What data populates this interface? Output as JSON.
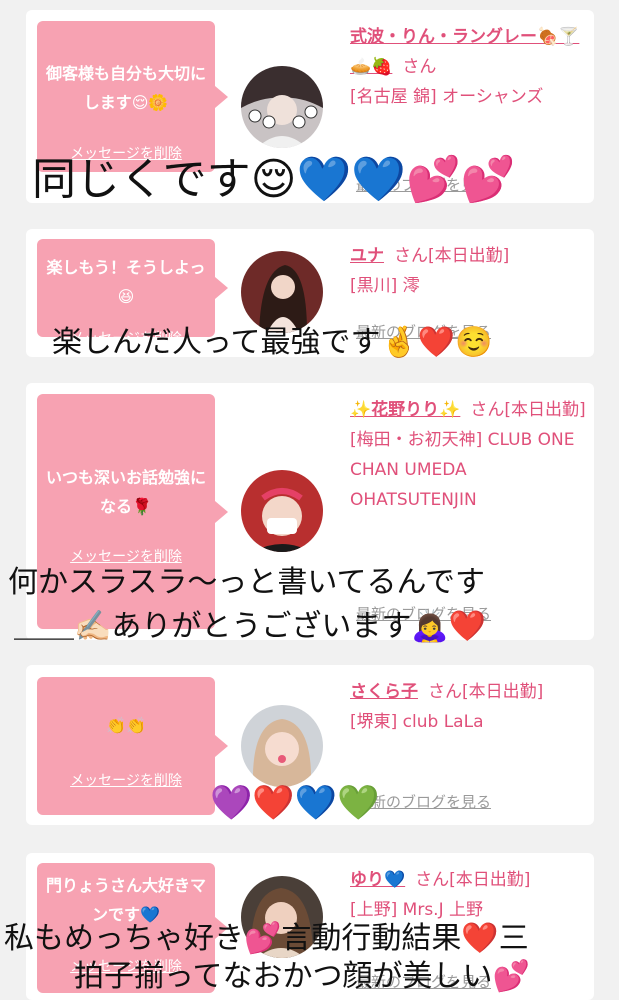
{
  "cards": [
    {
      "message": "御客様も自分も大切にします😌🌼",
      "delete_label": "メッセージを削除",
      "cast_name": "式波・りん・ラングレー🍖🍸🥧🍓",
      "honorific": "さん",
      "shop": "[名古屋 錦] オーシャンズ",
      "blog_label": "最新のブログを見る"
    },
    {
      "message": "楽しもう！そうしよっ😆",
      "delete_label": "メッセージを削除",
      "cast_name": "ユナ",
      "honorific": "さん[本日出勤]",
      "shop": "[黒川] 澪",
      "blog_label": "最新のブログを見る"
    },
    {
      "message": "いつも深いお話勉強になる🌹",
      "delete_label": "メッセージを削除",
      "cast_name": "✨花野りり✨",
      "honorific": "さん[本日出勤]",
      "shop": "[梅田・お初天神] CLUB ONE CHAN UMEDA OHATSUTENJIN",
      "blog_label": "最新のブログを見る"
    },
    {
      "message": "👏👏",
      "delete_label": "メッセージを削除",
      "cast_name": "さくら子",
      "honorific": "さん[本日出勤]",
      "shop": "[堺東] club LaLa",
      "blog_label": "最新のブログを見る"
    },
    {
      "message": "門りょうさん大好きマンです💙",
      "delete_label": "メッセージを削除",
      "cast_name": "ゆり💙",
      "honorific": "さん[本日出勤]",
      "shop": "[上野] Mrs.J 上野",
      "blog_label": "最新のブログを見る"
    }
  ],
  "overlays": {
    "line1": "同じくです😌💙💙💕💕",
    "line2": "楽しんだ人って最強です🤞❤️☺️",
    "line3a": "何かスラスラ〜っと書いてるんです",
    "line3b": "＿＿✍🏻ありがとうございます🙇‍♀️❤️",
    "line4": "💜❤️💙💚",
    "line5a": "私もめっちゃ好き💕言動行動結果❤️三",
    "line5b": "拍子揃ってなおかつ顔が美しい💕"
  },
  "colors": {
    "bubble": "#f7a2b2",
    "accent_text": "#e0507a",
    "page_bg": "#f1f1f1"
  }
}
